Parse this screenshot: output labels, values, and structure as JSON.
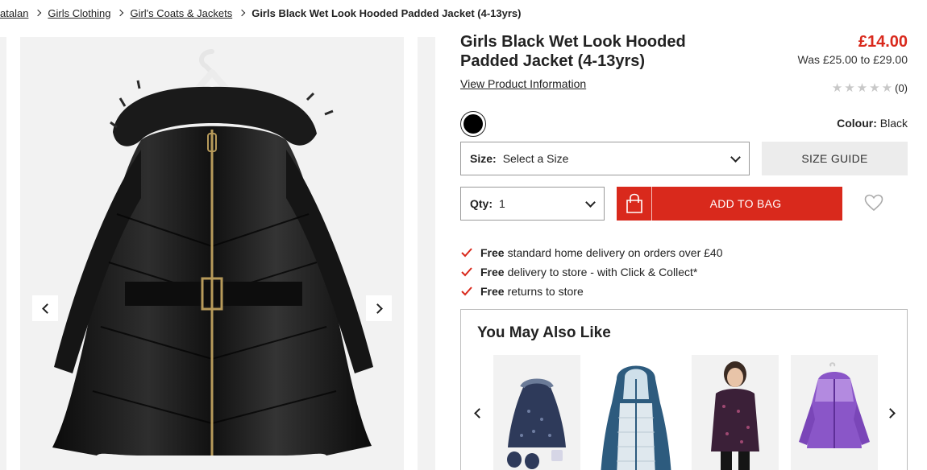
{
  "breadcrumb": {
    "items": [
      "atalan",
      "Girls Clothing",
      "Girl's Coats & Jackets"
    ],
    "current": "Girls Black Wet Look Hooded Padded Jacket (4-13yrs)"
  },
  "product": {
    "title": "Girls Black Wet Look Hooded Padded Jacket (4-13yrs)",
    "price": "£14.00",
    "was_price": "Was £25.00 to £29.00",
    "view_info_label": "View Product Information",
    "rating_count": "(0)",
    "rating_stars": 0,
    "colour_label": "Colour:",
    "colour_value": "Black",
    "swatch_color": "#000000"
  },
  "size": {
    "label": "Size:",
    "value": "Select a Size"
  },
  "size_guide_label": "SIZE GUIDE",
  "qty": {
    "label": "Qty:",
    "value": "1"
  },
  "add_to_bag_label": "ADD TO BAG",
  "benefits": [
    {
      "bold": "Free",
      "text": "standard home delivery on orders over £40"
    },
    {
      "bold": "Free",
      "text": "delivery to store - with Click & Collect*"
    },
    {
      "bold": "Free",
      "text": "returns to store"
    }
  ],
  "recommendations": {
    "title": "You May Also Like"
  },
  "colors": {
    "accent": "#d9291c",
    "text": "#222222",
    "image_bg": "#f2f2f2"
  }
}
